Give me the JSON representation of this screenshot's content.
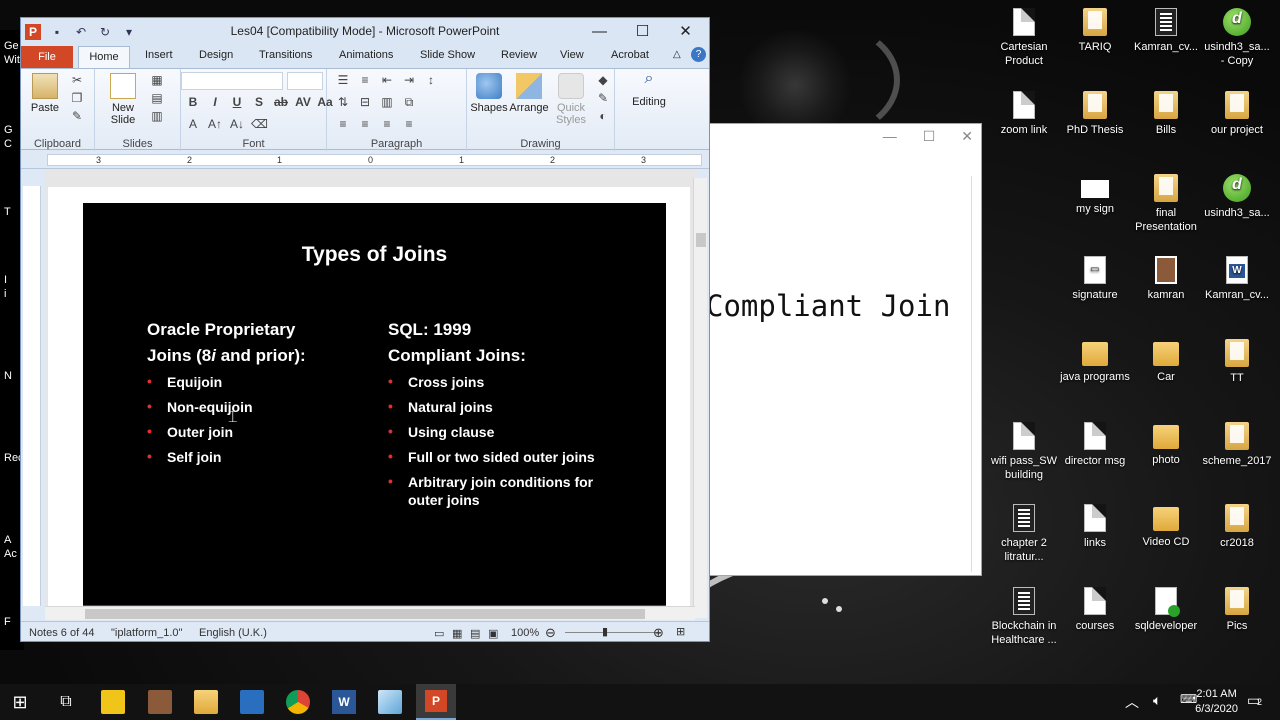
{
  "powerpoint": {
    "title": "Les04 [Compatibility Mode]  -  Microsoft PowerPoint",
    "window_controls": {
      "minimize": "—",
      "maximize": "☐",
      "close": "✕"
    },
    "tabs": [
      "File",
      "Home",
      "Insert",
      "Design",
      "Transitions",
      "Animations",
      "Slide Show",
      "Review",
      "View",
      "Acrobat"
    ],
    "ribbon": {
      "clipboard": {
        "paste": "Paste",
        "label": "Clipboard"
      },
      "slides": {
        "new_slide": "New Slide",
        "label": "Slides"
      },
      "font": {
        "label": "Font"
      },
      "paragraph": {
        "label": "Paragraph"
      },
      "drawing": {
        "shapes": "Shapes",
        "arrange": "Arrange",
        "quick_styles": "Quick Styles",
        "label": "Drawing"
      },
      "editing": {
        "label": "Editing"
      }
    },
    "ruler_marks": [
      "3",
      "2",
      "1",
      "0",
      "1",
      "2",
      "3"
    ],
    "slide": {
      "title": "Types of Joins",
      "left_heading_1": "Oracle Proprietary",
      "left_heading_2a": "Joins (8",
      "left_heading_2i": "i",
      "left_heading_2b": " and prior):",
      "left_items": [
        "Equijoin",
        "Non-equijoin",
        "Outer join",
        "Self join"
      ],
      "right_heading_1": "SQL: 1999",
      "right_heading_2": "Compliant Joins:",
      "right_items": [
        "Cross joins",
        "Natural joins",
        "Using clause",
        "Full or two sided outer joins",
        "Arbitrary join conditions for outer joins"
      ]
    },
    "status": {
      "notes": "Notes 6 of 44",
      "theme": "\"iplatform_1.0\"",
      "language": "English (U.K.)",
      "zoom": "100%"
    }
  },
  "background_window": {
    "text": "Compliant Join"
  },
  "desktop_icons": [
    {
      "label": "Cartesian Product",
      "icon": "doc-icon"
    },
    {
      "label": "TARIQ",
      "icon": "folder-doc-icon"
    },
    {
      "label": "Kamran_cv...",
      "icon": "dark-doc-icon"
    },
    {
      "label": "usindh3_sa... - Copy",
      "icon": "green-app-icon"
    },
    {
      "label": "zoom link",
      "icon": "doc-icon"
    },
    {
      "label": "PhD Thesis",
      "icon": "folder-doc-icon"
    },
    {
      "label": "Bills",
      "icon": "folder-doc-icon"
    },
    {
      "label": "our project",
      "icon": "folder-doc-icon"
    },
    {
      "label": "my sign",
      "icon": "image-icon"
    },
    {
      "label": "final Presentation",
      "icon": "folder-doc-icon"
    },
    {
      "label": "usindh3_sa...",
      "icon": "green-app-icon"
    },
    {
      "label": "signature",
      "icon": "doc-icon"
    },
    {
      "label": "kamran",
      "icon": "photo-icon"
    },
    {
      "label": "Kamran_cv...",
      "icon": "word-icon"
    },
    {
      "label": "java programs",
      "icon": "folder-icon"
    },
    {
      "label": "Car",
      "icon": "folder-icon"
    },
    {
      "label": "TT",
      "icon": "folder-doc-icon"
    },
    {
      "label": "wifi pass_SW building",
      "icon": "doc-icon"
    },
    {
      "label": "director msg",
      "icon": "doc-icon"
    },
    {
      "label": "photo",
      "icon": "folder-icon"
    },
    {
      "label": "scheme_2017",
      "icon": "folder-doc-icon"
    },
    {
      "label": "chapter 2 litratur...",
      "icon": "dark-doc-icon"
    },
    {
      "label": "links",
      "icon": "doc-icon"
    },
    {
      "label": "Video CD",
      "icon": "folder-icon"
    },
    {
      "label": "cr2018",
      "icon": "folder-doc-icon"
    },
    {
      "label": "Blockchain in Healthcare ...",
      "icon": "dark-doc-icon"
    },
    {
      "label": "courses",
      "icon": "doc-icon"
    },
    {
      "label": "sqldeveloper",
      "icon": "sqldev-icon"
    },
    {
      "label": "Pics",
      "icon": "folder-doc-icon"
    }
  ],
  "left_sliver_text": [
    "Ge",
    "Wit",
    "G",
    "C",
    "T",
    "I",
    "i",
    "N",
    "Rec",
    "A",
    "Ac",
    "F"
  ],
  "taskbar": {
    "time": "2:01 AM",
    "date": "6/3/2020",
    "notification_count": "2"
  }
}
